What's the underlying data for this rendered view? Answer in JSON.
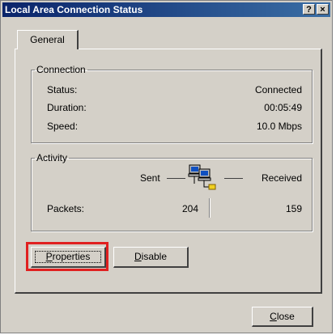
{
  "window": {
    "title": "Local Area Connection Status",
    "help_glyph": "?",
    "close_glyph": "×"
  },
  "tabs": [
    {
      "label": "General"
    }
  ],
  "connection": {
    "legend": "Connection",
    "rows": [
      {
        "label": "Status:",
        "value": "Connected"
      },
      {
        "label": "Duration:",
        "value": "00:05:49"
      },
      {
        "label": "Speed:",
        "value": "10.0 Mbps"
      }
    ]
  },
  "activity": {
    "legend": "Activity",
    "sent_label": "Sent",
    "received_label": "Received",
    "packets_label": "Packets:",
    "packets_sent": "204",
    "packets_received": "159",
    "icon": "network-computers-icon"
  },
  "buttons": {
    "properties_first": "P",
    "properties_rest": "roperties",
    "disable_first": "D",
    "disable_rest": "isable",
    "close_first": "C",
    "close_rest": "lose"
  },
  "colors": {
    "title_start": "#0a246a",
    "title_end": "#3a6ea5",
    "face": "#d4d0c8",
    "highlight": "#e02020"
  }
}
